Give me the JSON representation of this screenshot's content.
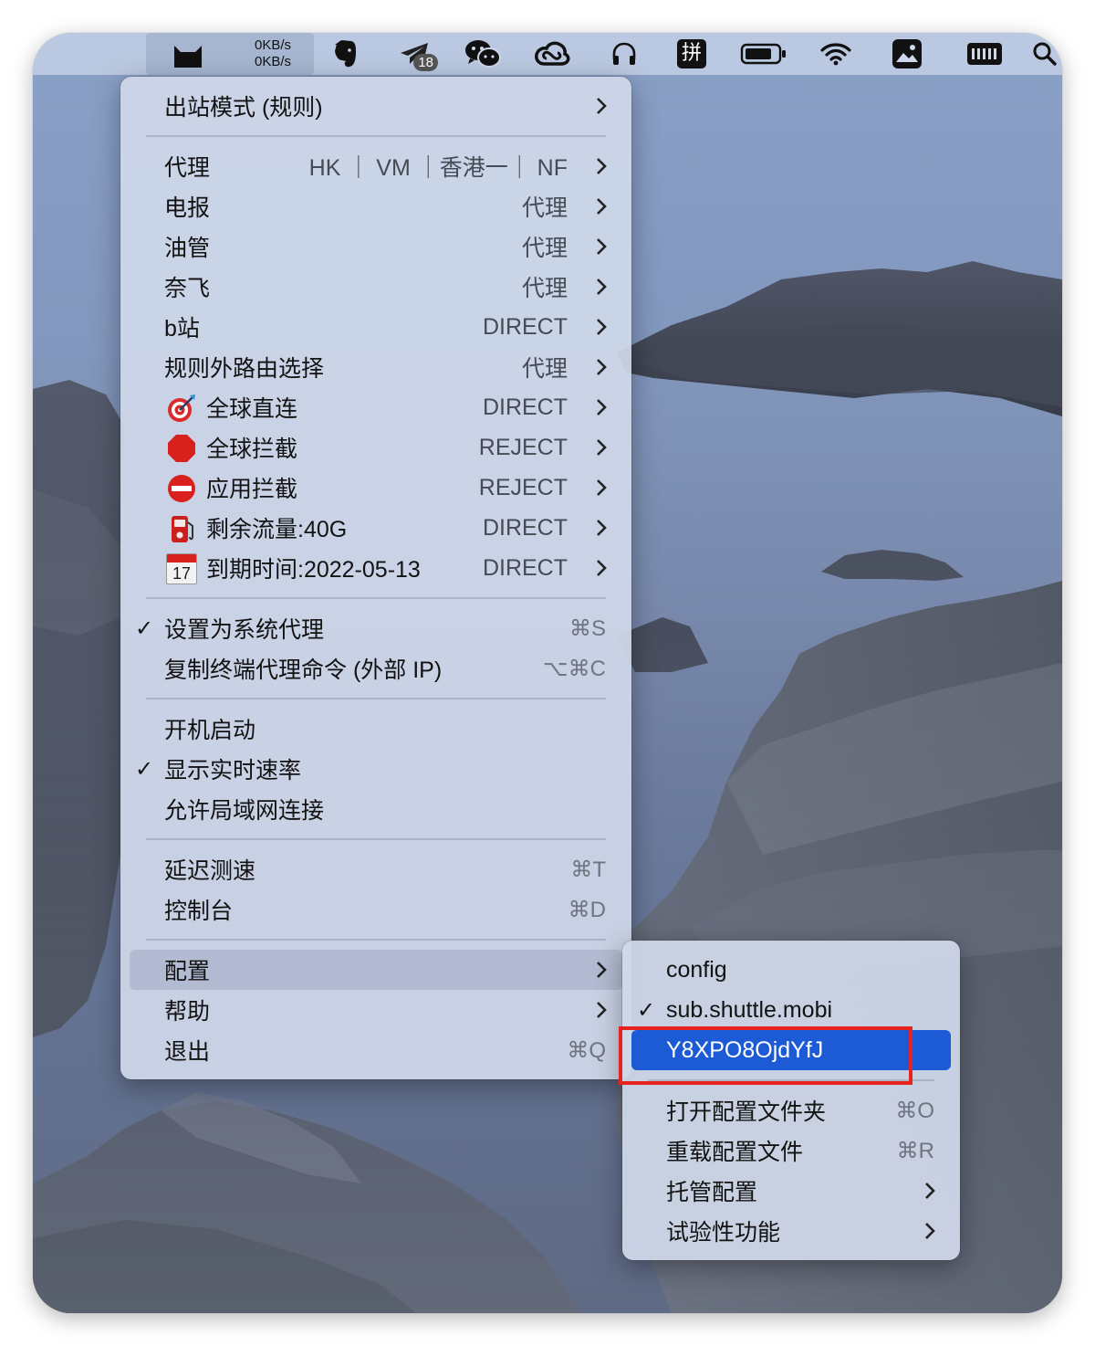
{
  "menubar": {
    "speed_up": "0KB/s",
    "speed_down": "0KB/s",
    "telegram_badge": "18",
    "icons": [
      "clash-cat-icon",
      "evernote-icon",
      "telegram-icon",
      "wechat-icon",
      "creative-cloud-icon",
      "headphones-icon",
      "pinyin-input-icon",
      "battery-icon",
      "wifi-icon",
      "photo-icon",
      "keyboard-icon",
      "search-icon"
    ],
    "pinyin_label": "拼"
  },
  "main_menu": {
    "outbound_mode": "出站模式 (规则)",
    "proxy_groups": [
      {
        "label": "代理",
        "value": "HK ｜ VM ｜香港一｜ NF"
      },
      {
        "label": "电报",
        "value": "代理"
      },
      {
        "label": "油管",
        "value": "代理"
      },
      {
        "label": "奈飞",
        "value": "代理"
      },
      {
        "label": "b站",
        "value": "DIRECT"
      },
      {
        "label": "规则外路由选择",
        "value": "代理"
      },
      {
        "label": "全球直连",
        "value": "DIRECT",
        "icon": "target-icon"
      },
      {
        "label": "全球拦截",
        "value": "REJECT",
        "icon": "stop-sign-icon"
      },
      {
        "label": "应用拦截",
        "value": "REJECT",
        "icon": "no-entry-icon"
      },
      {
        "label": "剩余流量:40G",
        "value": "DIRECT",
        "icon": "fuel-pump-icon"
      },
      {
        "label": "到期时间:2022-05-13",
        "value": "DIRECT",
        "icon": "calendar-icon"
      }
    ],
    "calendar_day": "17",
    "system_proxy": {
      "label": "设置为系统代理",
      "shortcut": "⌘S",
      "checked": "✓"
    },
    "copy_command": {
      "label": "复制终端代理命令 (外部 IP)",
      "shortcut": "⌥⌘C"
    },
    "launch_at_login": {
      "label": "开机启动"
    },
    "show_speed": {
      "label": "显示实时速率",
      "checked": "✓"
    },
    "allow_lan": {
      "label": "允许局域网连接"
    },
    "benchmark": {
      "label": "延迟测速",
      "shortcut": "⌘T"
    },
    "dashboard": {
      "label": "控制台",
      "shortcut": "⌘D"
    },
    "config": {
      "label": "配置"
    },
    "help": {
      "label": "帮助"
    },
    "quit": {
      "label": "退出",
      "shortcut": "⌘Q"
    }
  },
  "sub_menu": {
    "profiles": [
      {
        "label": "config",
        "checked": ""
      },
      {
        "label": "sub.shuttle.mobi",
        "checked": "✓"
      },
      {
        "label": "Y8XPO8OjdYfJ",
        "checked": ""
      }
    ],
    "open_folder": {
      "label": "打开配置文件夹",
      "shortcut": "⌘O"
    },
    "reload": {
      "label": "重载配置文件",
      "shortcut": "⌘R"
    },
    "managed": {
      "label": "托管配置"
    },
    "experimental": {
      "label": "试验性功能"
    }
  },
  "colors": {
    "selection": "#1d5bd6",
    "annotation_box": "#e8231f"
  }
}
